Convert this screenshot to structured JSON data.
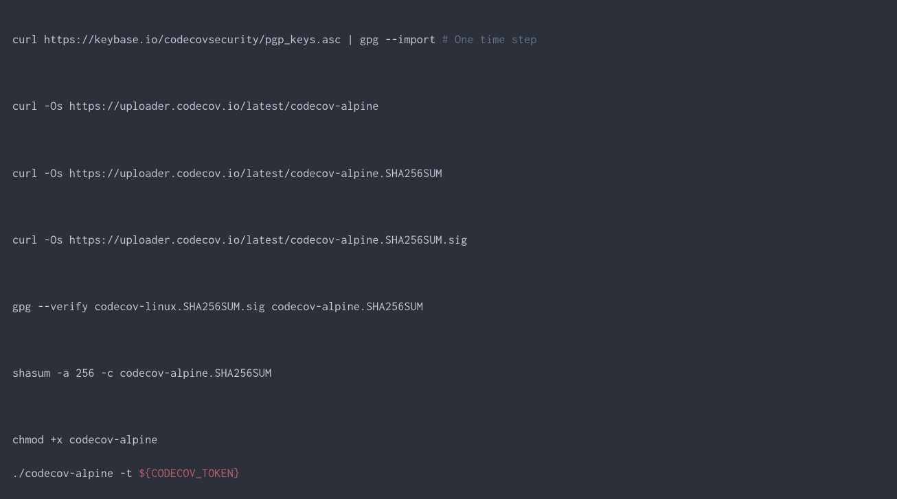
{
  "code": {
    "line1_cmd": "curl https://keybase.io/codecovsecurity/pgp_keys.asc | gpg --import ",
    "line1_comment": "# One time step",
    "line2": "curl -Os https://uploader.codecov.io/latest/codecov-alpine",
    "line3": "curl -Os https://uploader.codecov.io/latest/codecov-alpine.SHA256SUM",
    "line4": "curl -Os https://uploader.codecov.io/latest/codecov-alpine.SHA256SUM.sig",
    "line5": "gpg --verify codecov-linux.SHA256SUM.sig codecov-alpine.SHA256SUM",
    "line6": "shasum -a 256 -c codecov-alpine.SHA256SUM",
    "line7": "chmod +x codecov-alpine",
    "line8_cmd": "./codecov-alpine -t ",
    "line8_var": "${CODECOV_TOKEN}"
  }
}
